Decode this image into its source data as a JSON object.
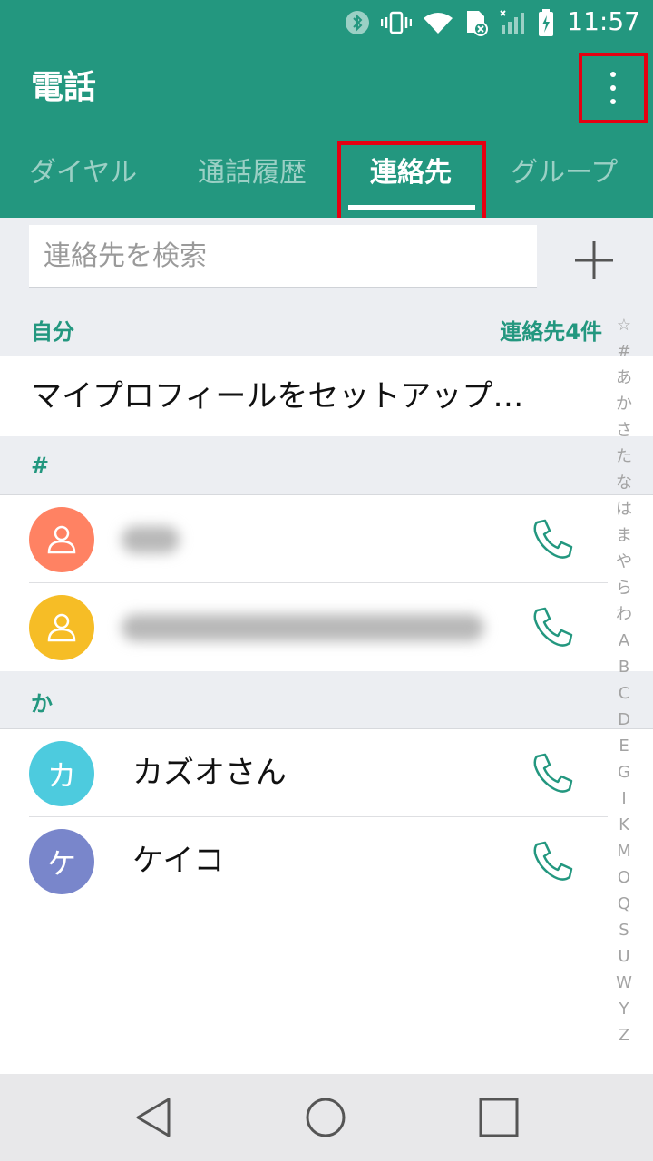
{
  "status_bar": {
    "time": "11:57"
  },
  "app": {
    "title": "電話"
  },
  "tabs": [
    {
      "label": "ダイヤル",
      "active": false
    },
    {
      "label": "通話履歴",
      "active": false
    },
    {
      "label": "連絡先",
      "active": true
    },
    {
      "label": "グループ",
      "active": false
    }
  ],
  "search": {
    "placeholder": "連絡先を検索"
  },
  "sections": {
    "self": {
      "label": "自分",
      "count": "連絡先4件"
    },
    "hash": {
      "label": "#"
    },
    "ka": {
      "label": "か"
    }
  },
  "profile": {
    "label": "マイプロフィールをセットアップ…"
  },
  "contacts": [
    {
      "name": "",
      "avatar_text": "",
      "avatar_color": "#ff8263",
      "blurred": true
    },
    {
      "name": "",
      "avatar_text": "",
      "avatar_color": "#f6bd26",
      "blurred": true
    },
    {
      "name": "カズオさん",
      "avatar_text": "カ",
      "avatar_color": "#4dcbde",
      "blurred": false
    },
    {
      "name": "ケイコ",
      "avatar_text": "ケ",
      "avatar_color": "#7986cb",
      "blurred": false
    }
  ],
  "index_letters": [
    "☆",
    "#",
    "あ",
    "か",
    "さ",
    "た",
    "な",
    "は",
    "ま",
    "や",
    "ら",
    "わ",
    "A",
    "B",
    "C",
    "D",
    "E",
    "G",
    "I",
    "K",
    "M",
    "O",
    "Q",
    "S",
    "U",
    "W",
    "Y",
    "Z"
  ],
  "colors": {
    "primary": "#23977f",
    "highlight": "#e50012",
    "section_bg": "#eceef2"
  }
}
